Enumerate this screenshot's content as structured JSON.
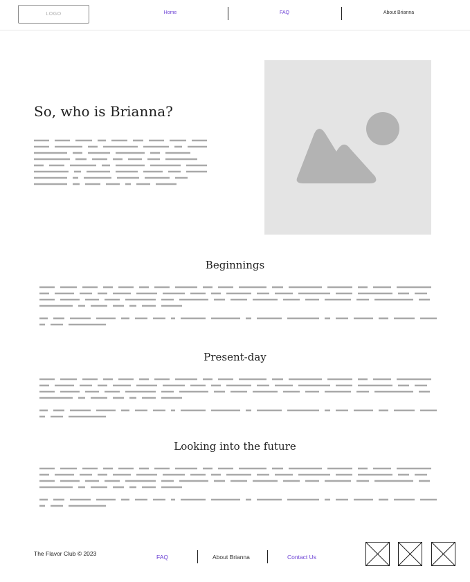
{
  "nav": {
    "logo": "LOGO",
    "links": [
      "Home",
      "FAQ",
      "About Brianna"
    ]
  },
  "hero": {
    "title": "So, who is Brianna?",
    "image_icon": "image-placeholder-icon"
  },
  "sections": [
    {
      "title": "Beginnings"
    },
    {
      "title": "Present-day"
    },
    {
      "title": "Looking into the future"
    }
  ],
  "footer": {
    "copyright": "The Flavor Club © 2023",
    "links": [
      "FAQ",
      "About Brianna",
      "Contact Us"
    ],
    "social_icons": [
      "social-icon-1",
      "social-icon-2",
      "social-icon-3"
    ]
  },
  "colors": {
    "accent": "#6a3fd4",
    "placeholder_text": "#a9a9a9",
    "image_bg": "#e4e4e4",
    "image_shape": "#b3b3b3"
  }
}
